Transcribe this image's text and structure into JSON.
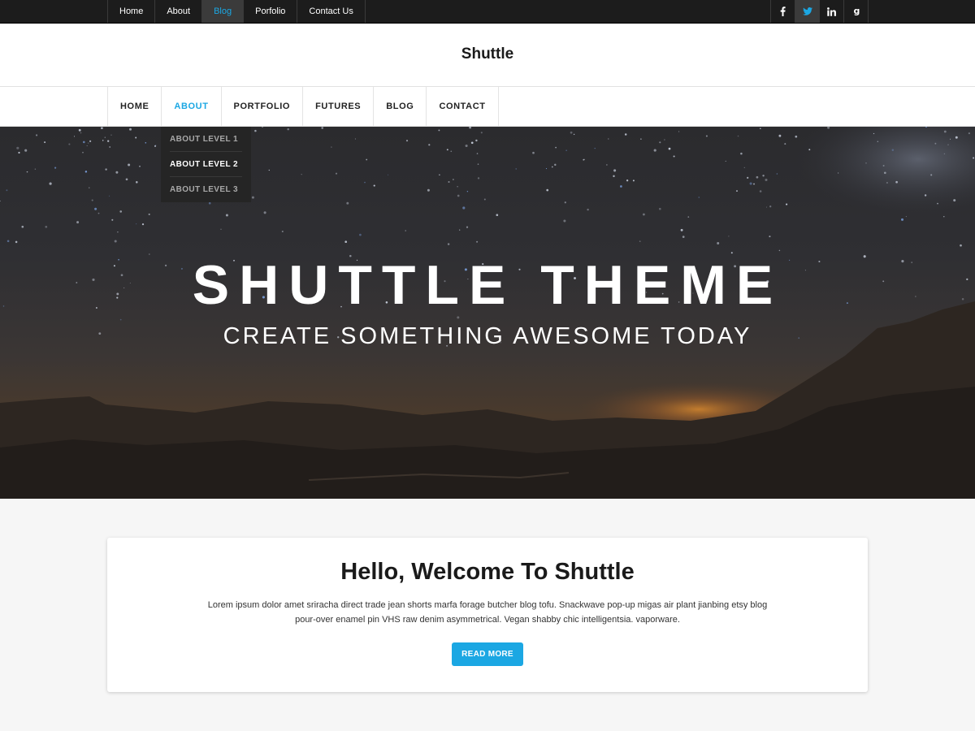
{
  "topbar": {
    "nav": [
      "Home",
      "About",
      "Blog",
      "Porfolio",
      "Contact Us"
    ],
    "active_index": 2,
    "social": [
      {
        "icon": "facebook-icon",
        "glyph": "f"
      },
      {
        "icon": "twitter-icon",
        "glyph": "t"
      },
      {
        "icon": "linkedin-icon",
        "glyph": "in"
      },
      {
        "icon": "google-plus-icon",
        "glyph": "g"
      }
    ]
  },
  "header": {
    "title": "Shuttle"
  },
  "mainnav": {
    "items": [
      "HOME",
      "ABOUT",
      "PORTFOLIO",
      "FUTURES",
      "BLOG",
      "CONTACT"
    ],
    "active_index": 1
  },
  "dropdown": {
    "items": [
      "ABOUT LEVEL 1",
      "ABOUT LEVEL 2",
      "ABOUT LEVEL 3"
    ],
    "active_index": 1
  },
  "hero": {
    "title": "SHUTTLE THEME",
    "subtitle": "CREATE SOMETHING AWESOME TODAY"
  },
  "welcome": {
    "title": "Hello, Welcome To Shuttle",
    "text": "Lorem ipsum dolor amet sriracha direct trade jean shorts marfa forage butcher blog tofu. Snackwave pop-up migas air plant  jianbing etsy blog pour-over enamel pin VHS raw denim asymmetrical. Vegan shabby chic intelligentsia. vaporware.",
    "button": "READ MORE"
  },
  "colors": {
    "accent": "#1ba7e3",
    "topbar": "#1c1c1c",
    "dropdown": "#252525"
  }
}
